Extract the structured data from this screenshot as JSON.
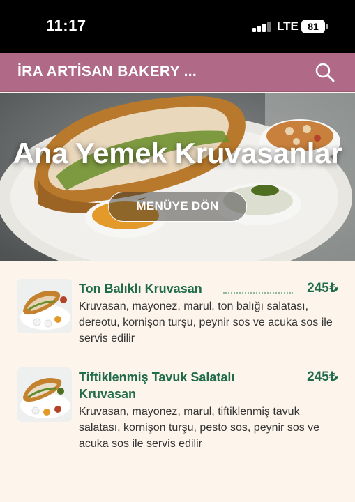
{
  "status_bar": {
    "time": "11:17",
    "network": "LTE",
    "battery": "81"
  },
  "header": {
    "title": "İRA ARTİSAN BAKERY ...",
    "search_icon": "search-icon"
  },
  "hero": {
    "title": "Ana Yemek Kruvasanlar",
    "button_label": "MENÜYE DÖN"
  },
  "menu_items": [
    {
      "name": "Ton Balıklı Kruvasan",
      "price": "245₺",
      "description": "Kruvasan, mayonez, marul, ton balığı salatası, dereotu, kornişon turşu, peynir sos ve acuka sos ile servis edilir"
    },
    {
      "name": "Tiftiklenmiş Tavuk Salatalı Kruvasan",
      "price": "245₺",
      "description": "Kruvasan, mayonez, marul, tiftiklenmiş tavuk salatası, kornişon turşu, pesto sos, peynir sos ve acuka sos ile servis edilir"
    }
  ],
  "colors": {
    "header": "#b06a87",
    "accent_green": "#1f6b4a",
    "background": "#fdf5ec"
  }
}
